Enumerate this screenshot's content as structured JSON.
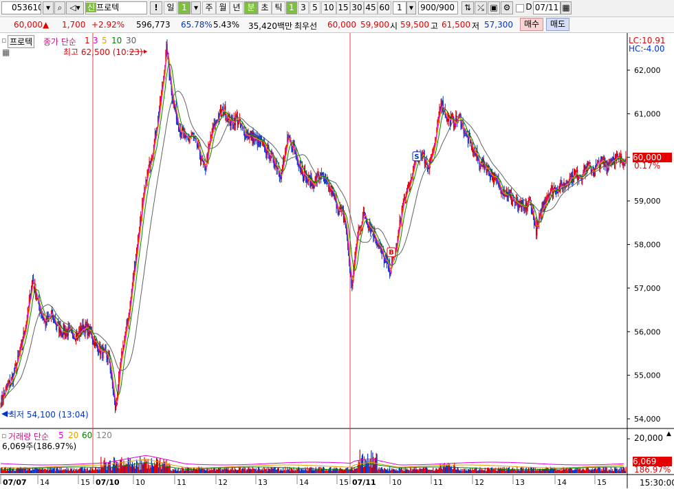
{
  "toolbar": {
    "code": "053610",
    "market_badge": "신",
    "name": "프로텍",
    "alert": "!",
    "period_day": "일",
    "period_num": "1",
    "week": "주",
    "month": "월",
    "year": "년",
    "minute": "분",
    "second": "초",
    "tick": "틱",
    "intervals": [
      "1",
      "3",
      "5",
      "10",
      "15",
      "30",
      "45",
      "60"
    ],
    "count_input": "1",
    "range": "900/900",
    "date": "07/11",
    "d_label": "D"
  },
  "quote": {
    "price": "60,000",
    "arrow": "▲",
    "change": "1,700",
    "change_pct": "+2.92%",
    "volume": "596,773",
    "ratio": "65.78%",
    "turnover": "5.43%",
    "amount": "35,420백만",
    "best_label": "최우선",
    "ask": "60,000",
    "bid": "59,900",
    "open_label": "시",
    "open": "59,500",
    "high_label": "고",
    "high": "61,500",
    "low_label": "저",
    "low": "57,300",
    "buy": "매수",
    "sell": "매도"
  },
  "legend": {
    "stock": "프로텍",
    "ma_label": "종가 단순",
    "ma_periods": [
      "1",
      "3",
      "5",
      "10",
      "30"
    ],
    "max_marker": "최고 62,500 (10:23)",
    "min_marker": "최저 54,100 (13:04)"
  },
  "volume_legend": {
    "label": "거래량 단순",
    "periods": [
      "5",
      "20",
      "60",
      "120"
    ],
    "value": "6,069주(186.97%)"
  },
  "right_info": {
    "lc": "LC:10.91",
    "hc": "HC:-4.00",
    "price_tag": "60,000",
    "price_pct": "0.17%",
    "vol_tag": "6,069",
    "vol_pct": "186.97%",
    "vol_axis": "20,000",
    "time": "15:30:00"
  },
  "colors": {
    "up": "#e60000",
    "down": "#0033cc",
    "ma3": "#e000e0",
    "ma5": "#e0a000",
    "ma10": "#008000",
    "ma30": "#606060"
  },
  "chart_data": {
    "type": "candlestick",
    "y_ticks": [
      62000,
      61000,
      60000,
      59000,
      58000,
      57000,
      56000,
      55000,
      54000
    ],
    "ylim": [
      53800,
      62700
    ],
    "x_labels": [
      "07/07",
      "14",
      "15",
      "07/10",
      "10",
      "11",
      "12",
      "13",
      "14",
      "15",
      "07/11",
      "10",
      "11",
      "12",
      "13",
      "14",
      "15"
    ],
    "close_path": [
      54400,
      54700,
      55000,
      55500,
      56200,
      57200,
      56600,
      56200,
      56400,
      56100,
      56000,
      56000,
      55900,
      56100,
      56000,
      55700,
      55500,
      55400,
      54200,
      55500,
      56300,
      57500,
      58700,
      59600,
      60300,
      61200,
      62500,
      61300,
      60700,
      60400,
      60500,
      60200,
      59700,
      60500,
      60900,
      61100,
      60800,
      60900,
      60600,
      60500,
      60400,
      60300,
      60100,
      59900,
      59600,
      60400,
      60200,
      59800,
      59500,
      59400,
      59600,
      59400,
      59200,
      58800,
      58600,
      57000,
      58300,
      58700,
      58400,
      58100,
      57700,
      57400,
      57900,
      58900,
      59300,
      59900,
      60100,
      59800,
      60200,
      61300,
      60900,
      60800,
      60900,
      60500,
      60200,
      59900,
      59800,
      59600,
      59400,
      59200,
      59100,
      58900,
      58800,
      59000,
      58300,
      58900,
      59200,
      59300,
      59300,
      59500,
      59600,
      59600,
      59800,
      59700,
      59900,
      59800,
      60000,
      59900,
      60000
    ],
    "markers": [
      {
        "text": "S",
        "price": 60000
      },
      {
        "text": "B",
        "price": 57800
      }
    ],
    "volume_max": 20000
  }
}
